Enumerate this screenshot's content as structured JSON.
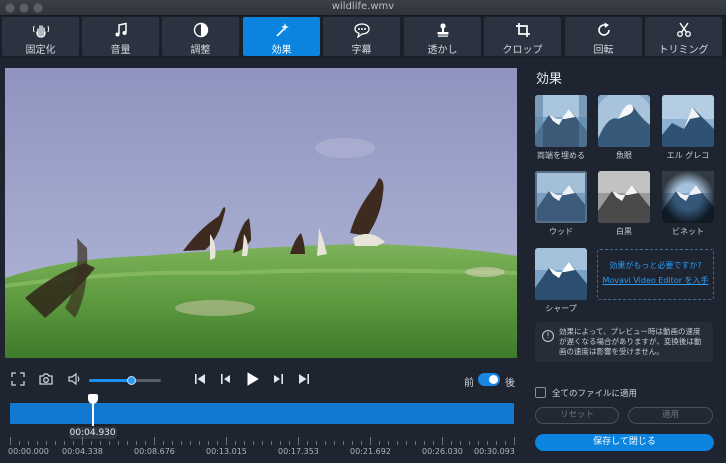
{
  "window": {
    "title": "wildlife.wmv"
  },
  "toolbar": {
    "items": [
      {
        "label": "固定化",
        "icon": "stabilize-hand-icon"
      },
      {
        "label": "音量",
        "icon": "music-note-icon"
      },
      {
        "label": "調整",
        "icon": "adjust-contrast-icon"
      },
      {
        "label": "効果",
        "icon": "magic-wand-icon",
        "active": true
      },
      {
        "label": "字幕",
        "icon": "speech-bubble-icon"
      },
      {
        "label": "透かし",
        "icon": "stamp-icon"
      },
      {
        "label": "クロップ",
        "icon": "crop-icon"
      },
      {
        "label": "回転",
        "icon": "rotate-icon"
      },
      {
        "label": "トリミング",
        "icon": "scissors-icon"
      }
    ]
  },
  "player": {
    "volume_level": 0.6,
    "compare_before": "前",
    "compare_after": "後",
    "compare_on": true
  },
  "timeline": {
    "current_time": "00:04.930",
    "playhead_fraction": 0.164,
    "tick_labels": [
      "00:00.000",
      "00:04.338",
      "00:08.676",
      "00:13.015",
      "00:17.353",
      "00:21.692",
      "00:26.030",
      "00:30.093"
    ]
  },
  "effects_panel": {
    "title": "効果",
    "effects": [
      {
        "label": "両端を埋める"
      },
      {
        "label": "魚眼"
      },
      {
        "label": "エル グレコ"
      },
      {
        "label": "ウッド"
      },
      {
        "label": "白黒"
      },
      {
        "label": "ビネット"
      },
      {
        "label": "シャープ"
      }
    ],
    "more_question": "効果がもっと必要ですか?",
    "more_link": "Movavi Video Editor を入手",
    "notice": "効果によって、プレビュー時は動画の速度が遅くなる場合がありますが、変換後は動画の速度は影響を受けません。",
    "apply_all_label": "全てのファイルに適用",
    "reset_label": "リセット",
    "apply_label": "適用",
    "save_close_label": "保存して閉じる"
  },
  "colors": {
    "accent": "#0b84e0",
    "background": "#1e2430"
  }
}
